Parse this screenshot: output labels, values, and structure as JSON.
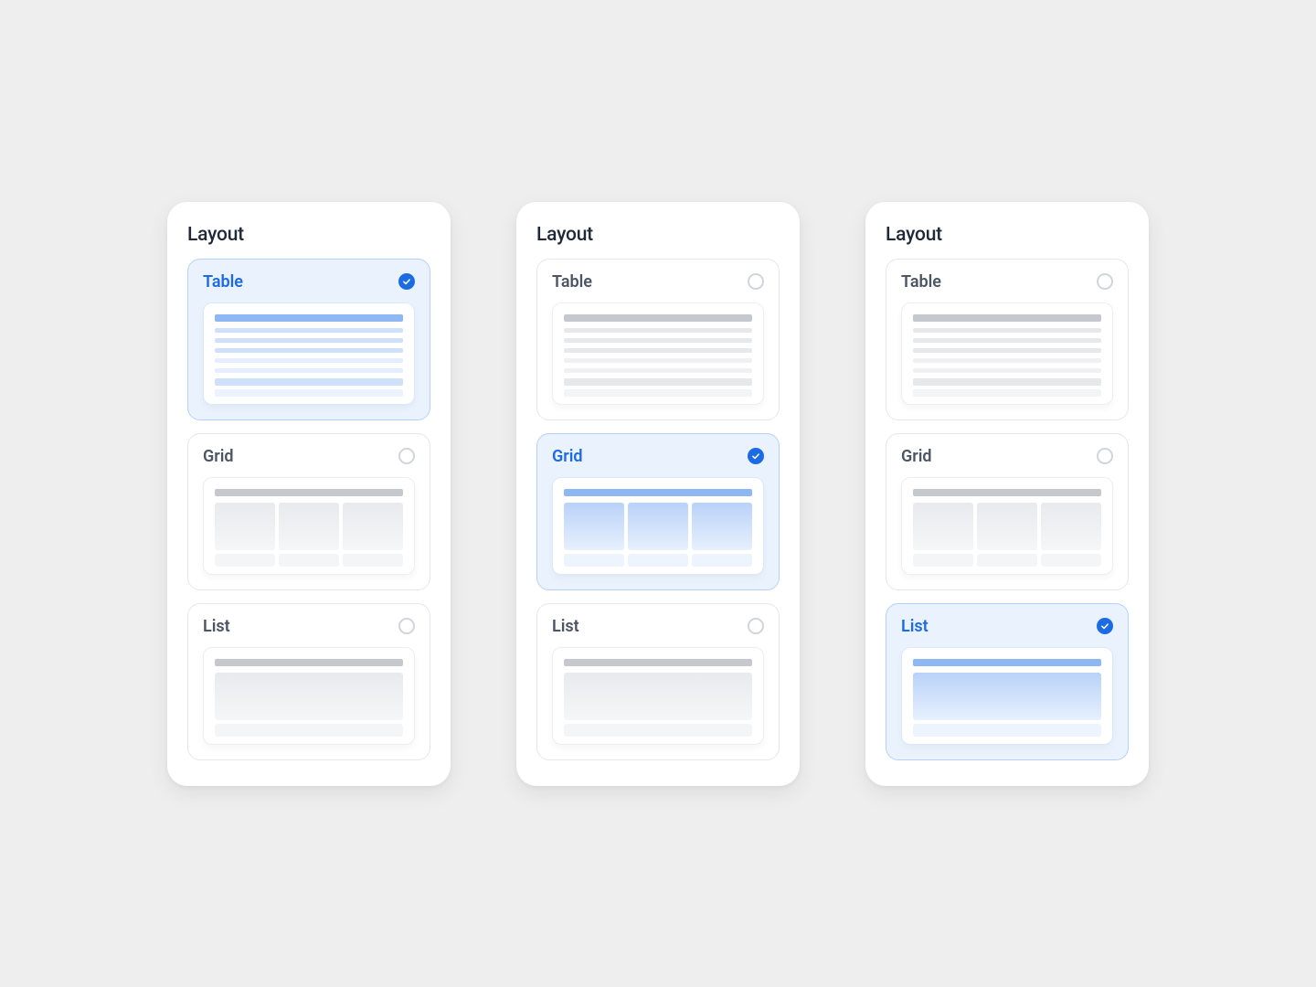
{
  "panels": [
    {
      "title": "Layout",
      "options": {
        "table": {
          "label": "Table",
          "selected": true
        },
        "grid": {
          "label": "Grid",
          "selected": false
        },
        "list": {
          "label": "List",
          "selected": false
        }
      }
    },
    {
      "title": "Layout",
      "options": {
        "table": {
          "label": "Table",
          "selected": false
        },
        "grid": {
          "label": "Grid",
          "selected": true
        },
        "list": {
          "label": "List",
          "selected": false
        }
      }
    },
    {
      "title": "Layout",
      "options": {
        "table": {
          "label": "Table",
          "selected": false
        },
        "grid": {
          "label": "Grid",
          "selected": false
        },
        "list": {
          "label": "List",
          "selected": true
        }
      }
    }
  ]
}
